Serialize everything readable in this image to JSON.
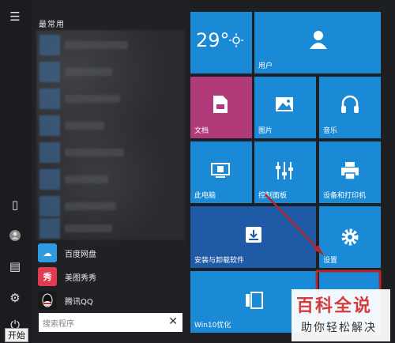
{
  "start_menu": {
    "section_title": "最常用",
    "start_label": "开始",
    "apps": [
      {
        "label": "百度网盘",
        "icon": "baidu-netdisk-icon",
        "color": "#2f9be0"
      },
      {
        "label": "美图秀秀",
        "icon": "meitu-icon",
        "color": "#e23a4e"
      },
      {
        "label": "腾讯QQ",
        "icon": "qq-icon",
        "color": "#1a1a1a"
      }
    ],
    "search": {
      "placeholder": "搜索程序"
    }
  },
  "tiles": [
    {
      "label": "",
      "temp": "29°",
      "icon": "weather-icon"
    },
    {
      "label": "用户",
      "icon": "user-icon"
    },
    {
      "label": "文档",
      "icon": "document-icon",
      "color": "#b03a7a"
    },
    {
      "label": "图片",
      "icon": "picture-icon"
    },
    {
      "label": "音乐",
      "icon": "headphones-icon"
    },
    {
      "label": "此电脑",
      "icon": "computer-icon"
    },
    {
      "label": "控制面板",
      "icon": "control-panel-icon"
    },
    {
      "label": "设备和打印机",
      "icon": "printer-icon"
    },
    {
      "label": "安装与卸载软件",
      "icon": "install-icon",
      "color": "#1f5aa6"
    },
    {
      "label": "设置",
      "icon": "gear-icon"
    },
    {
      "label": "Win10优化",
      "icon": "optimize-icon"
    }
  ],
  "watermark": {
    "top": "百科全说",
    "bottom": "助你轻松解决"
  },
  "colors": {
    "tile": "#1b8ad6",
    "highlight": "#b3272d"
  }
}
